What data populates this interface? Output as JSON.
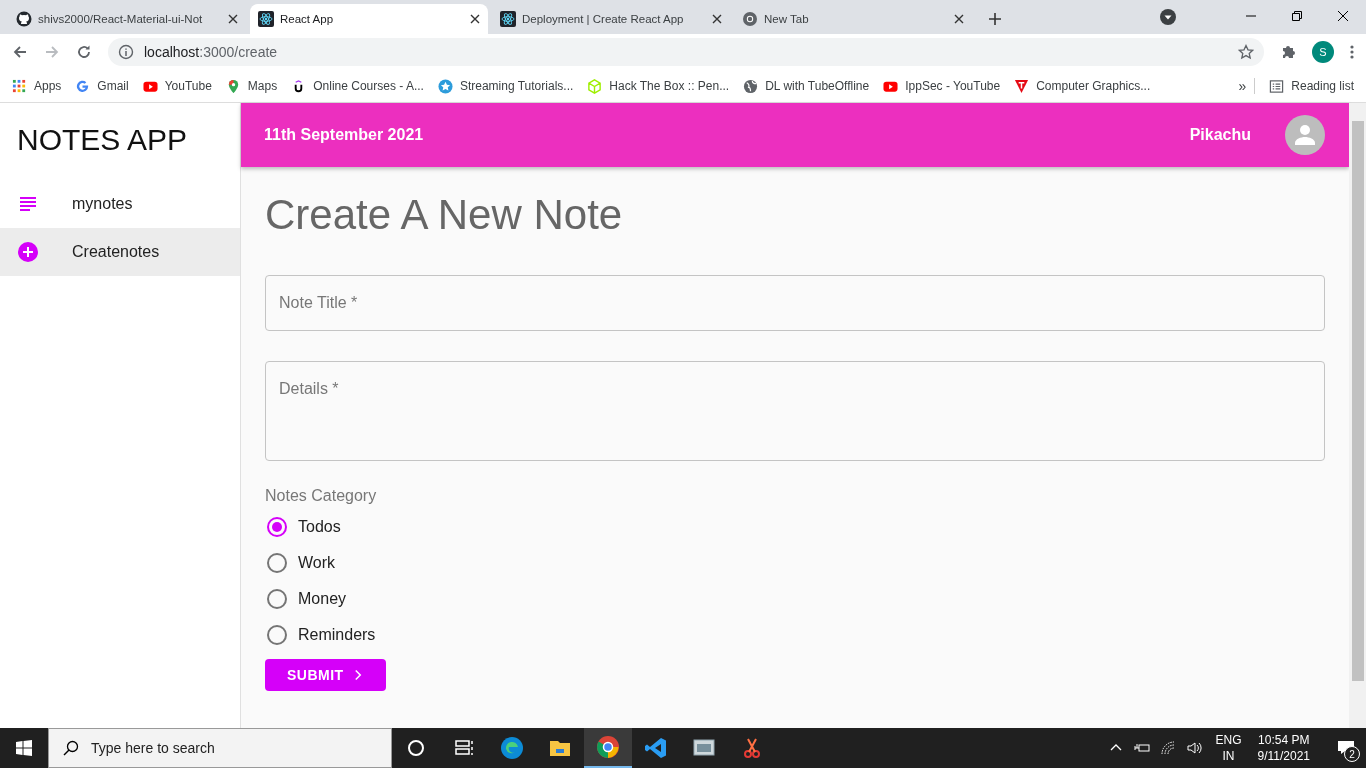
{
  "browser": {
    "tabs": [
      {
        "title": "shivs2000/React-Material-ui-Not",
        "kind": "github",
        "selected": false
      },
      {
        "title": "React App",
        "kind": "react",
        "selected": true
      },
      {
        "title": "Deployment | Create React App",
        "kind": "react",
        "selected": false
      },
      {
        "title": "New Tab",
        "kind": "chrome",
        "selected": false
      }
    ],
    "address_host": "localhost",
    "address_path": ":3000/create",
    "profile": "S",
    "bookmarks": [
      {
        "label": "Apps",
        "kind": "apps"
      },
      {
        "label": "Gmail",
        "kind": "google"
      },
      {
        "label": "YouTube",
        "kind": "youtube"
      },
      {
        "label": "Maps",
        "kind": "maps"
      },
      {
        "label": "Online Courses - A...",
        "kind": "udemy"
      },
      {
        "label": "Streaming Tutorials...",
        "kind": "star"
      },
      {
        "label": "Hack The Box :: Pen...",
        "kind": "cube"
      },
      {
        "label": "DL with TubeOffline",
        "kind": "globe"
      },
      {
        "label": "IppSec - YouTube",
        "kind": "youtube"
      },
      {
        "label": "Computer Graphics...",
        "kind": "t"
      }
    ],
    "more": "»",
    "reading_list": "Reading list"
  },
  "app": {
    "title": "NOTES APP",
    "nav": [
      {
        "label": "mynotes",
        "kind": "list",
        "selected": false
      },
      {
        "label": "Createnotes",
        "kind": "add",
        "selected": true
      }
    ],
    "date": "11th September 2021",
    "user": "Pikachu",
    "heading": "Create A New Note",
    "fields": [
      {
        "placeholder": "Note Title *",
        "kind": "single"
      },
      {
        "placeholder": "Details *",
        "kind": "multi"
      }
    ],
    "category_label": "Notes Category",
    "categories": [
      {
        "label": "Todos",
        "selected": true
      },
      {
        "label": "Work",
        "selected": false
      },
      {
        "label": "Money",
        "selected": false
      },
      {
        "label": "Reminders",
        "selected": false
      }
    ],
    "submit": "SUBMIT"
  },
  "taskbar": {
    "search_placeholder": "Type here to search",
    "apps": [
      {
        "kind": "cortana",
        "selected": false
      },
      {
        "kind": "taskview",
        "selected": false
      },
      {
        "kind": "edge",
        "selected": false
      },
      {
        "kind": "folder",
        "selected": false
      },
      {
        "kind": "chrome",
        "selected": true
      },
      {
        "kind": "vscode",
        "selected": false
      },
      {
        "kind": "window",
        "selected": false
      },
      {
        "kind": "tool",
        "selected": false
      }
    ],
    "language": "ENG",
    "region": "IN",
    "time": "10:54 PM",
    "date": "9/11/2021",
    "notifications": "2"
  }
}
